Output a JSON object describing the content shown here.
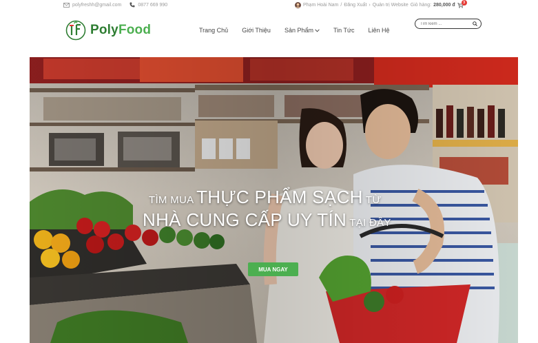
{
  "topbar": {
    "email": "polyfreshh@gmail.com",
    "phone": "0877 669 990",
    "user_name": "Phạm Hoài Nam",
    "sep1": "/",
    "logout": "Đăng Xuất",
    "admin_link": "Quản trị Website",
    "cart_label": "Giỏ hàng:",
    "cart_total": "280,000 đ",
    "cart_count": "3",
    "icons": [
      "mail-icon",
      "phone-icon",
      "user-avatar-icon",
      "cart-icon"
    ]
  },
  "brand": {
    "name_part1": "Poly",
    "name_part2": "Food",
    "colors": {
      "primary": "#2e7d32",
      "accent": "#4caf50"
    }
  },
  "nav": {
    "items": [
      {
        "label": "Trang Chủ"
      },
      {
        "label": "Giới Thiệu"
      },
      {
        "label": "Sản Phẩm"
      },
      {
        "label": "Tin Tức"
      },
      {
        "label": "Liên Hệ"
      }
    ]
  },
  "search": {
    "placeholder": "Tìm kiếm ...",
    "icon": "search-icon"
  },
  "hero": {
    "line1_small_a": "TÌM MUA ",
    "line1_big": "THỰC PHẨM SẠCH",
    "line1_small_b": " TỪ",
    "line2_big": "NHÀ CUNG CẤP UY TÍN",
    "line2_small": " TẠI ĐÂY",
    "cta_label": "MUA NGAY",
    "cta_color": "#4caf50"
  }
}
